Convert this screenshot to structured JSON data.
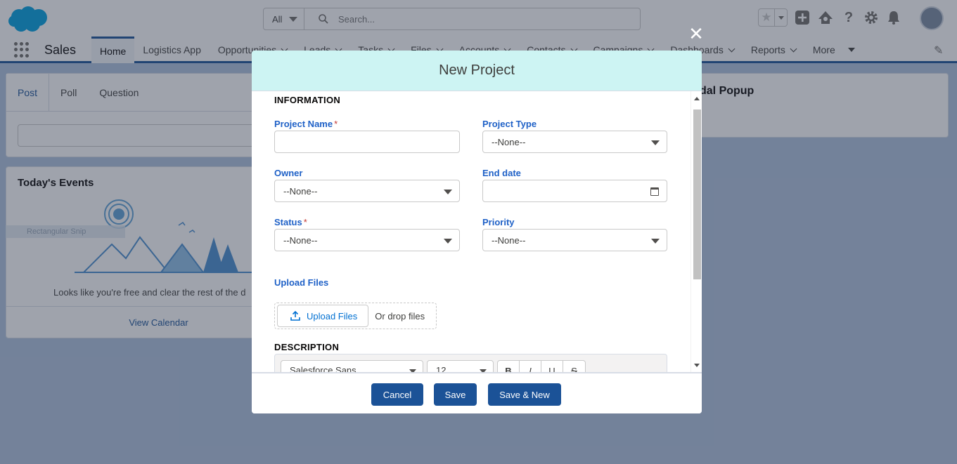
{
  "header": {
    "search_scope": "All",
    "search_placeholder": "Search..."
  },
  "appnav": {
    "app_name": "Sales",
    "items": [
      {
        "label": "Home",
        "active": true
      },
      {
        "label": "Logistics App"
      },
      {
        "label": "Opportunities"
      },
      {
        "label": "Leads"
      },
      {
        "label": "Tasks"
      },
      {
        "label": "Files"
      },
      {
        "label": "Accounts"
      },
      {
        "label": "Contacts"
      },
      {
        "label": "Campaigns"
      },
      {
        "label": "Dashboards"
      },
      {
        "label": "Reports"
      },
      {
        "label": "More"
      }
    ]
  },
  "background": {
    "publisher_tabs": [
      "Post",
      "Poll",
      "Question"
    ],
    "events_title": "Today's Events",
    "events_empty": "Looks like you're free and clear the rest of the d",
    "view_calendar": "View Calendar",
    "snip_label": "Rectangular Snip",
    "right_card_title": "dal Popup"
  },
  "modal": {
    "title": "New Project",
    "sections": {
      "information": "INFORMATION",
      "description": "DESCRIPTION"
    },
    "fields": {
      "project_name": {
        "label": "Project Name",
        "value": ""
      },
      "project_type": {
        "label": "Project Type",
        "value": "--None--"
      },
      "owner": {
        "label": "Owner",
        "value": "--None--"
      },
      "end_date": {
        "label": "End date",
        "value": ""
      },
      "status": {
        "label": "Status",
        "value": "--None--"
      },
      "priority": {
        "label": "Priority",
        "value": "--None--"
      }
    },
    "required_marker": "*",
    "upload": {
      "label": "Upload Files",
      "button": "Upload Files",
      "drop_text": "Or drop files"
    },
    "editor": {
      "font": "Salesforce Sans",
      "size": "12",
      "formats": [
        "B",
        "I",
        "U",
        "S"
      ]
    },
    "footer": {
      "cancel": "Cancel",
      "save": "Save",
      "save_new": "Save & New"
    }
  },
  "colors": {
    "brand": "#1b5297",
    "modal_header": "#cdf4f3",
    "label_blue": "#1f61c7",
    "required": "#c23934"
  }
}
